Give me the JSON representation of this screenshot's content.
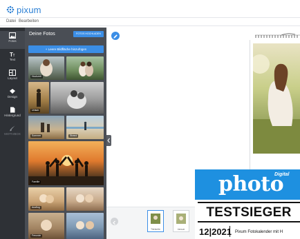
{
  "app": {
    "logo_text": "pixum",
    "brand_color": "#2a7fd4",
    "accent_color": "#3b8ee6"
  },
  "menu": {
    "items": [
      "Datei",
      "Bearbeiten"
    ]
  },
  "rail": {
    "items": [
      {
        "label": "Fotos",
        "icon": "photos-icon",
        "active": true
      },
      {
        "label": "Text",
        "icon": "text-icon"
      },
      {
        "label": "Layout",
        "icon": "layout-icon"
      },
      {
        "label": "Design",
        "icon": "design-icon"
      },
      {
        "label": "Hintergrund",
        "icon": "background-icon"
      },
      {
        "label": "MOTIVBOX",
        "icon": "brush-icon",
        "muted": true
      }
    ]
  },
  "panel": {
    "title": "Deine Fotos",
    "upload_label": "FOTOS HOCHLADEN",
    "link_label": "+ Leere Bildfläche hinzufügen",
    "tags": [
      "Hochzeit",
      "Urlaub",
      "Sommer",
      "Strand",
      "Familie",
      "Ausflug",
      "Freunde"
    ]
  },
  "pages": {
    "items": [
      "Titelseite",
      "Januar"
    ]
  },
  "badge": {
    "digital": "Digital",
    "photo": "photo",
    "testsieger": "TESTSIEGER",
    "year": "12|2021",
    "sub": "Pixum Fotokalender mit H"
  }
}
